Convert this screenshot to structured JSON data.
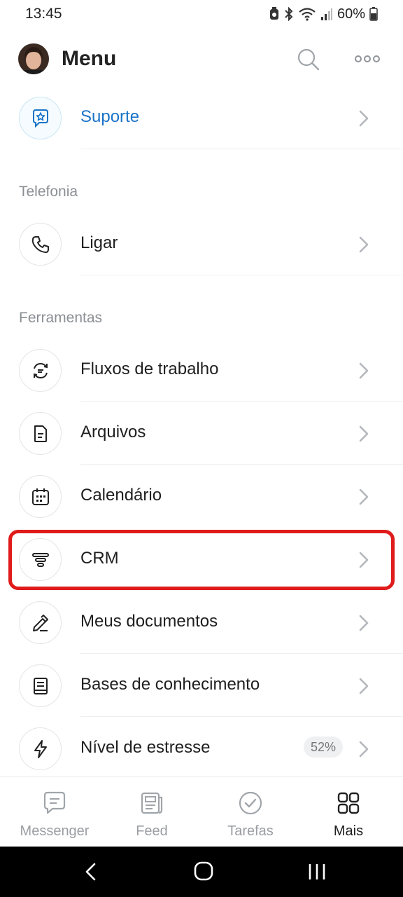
{
  "status_bar": {
    "time": "13:45",
    "battery": "60%"
  },
  "header": {
    "title": "Menu",
    "icons": [
      "avatar",
      "search-icon",
      "more-icon"
    ]
  },
  "support": {
    "label": "Suporte",
    "icon": "star-chat-icon",
    "accent": "#1a73c8"
  },
  "sections": {
    "telephony": "Telefonia",
    "tools": "Ferramentas"
  },
  "items": {
    "call": {
      "label": "Ligar",
      "icon": "phone-icon"
    },
    "workflows": {
      "label": "Fluxos de trabalho",
      "icon": "workflow-icon"
    },
    "files": {
      "label": "Arquivos",
      "icon": "file-icon"
    },
    "calendar": {
      "label": "Calendário",
      "icon": "calendar-icon"
    },
    "crm": {
      "label": "CRM",
      "icon": "funnel-icon"
    },
    "my_documents": {
      "label": "Meus documentos",
      "icon": "pen-icon"
    },
    "knowledge": {
      "label": "Bases de conhecimento",
      "icon": "book-icon"
    },
    "stress": {
      "label": "Nível de estresse",
      "icon": "lightning-icon",
      "badge": "52%"
    }
  },
  "highlight_color": "#e01b1b",
  "tabs": [
    {
      "label": "Messenger",
      "icon": "chat-icon",
      "active": false
    },
    {
      "label": "Feed",
      "icon": "news-icon",
      "active": false
    },
    {
      "label": "Tarefas",
      "icon": "check-circle-icon",
      "active": false
    },
    {
      "label": "Mais",
      "icon": "grid-icon",
      "active": true
    }
  ]
}
